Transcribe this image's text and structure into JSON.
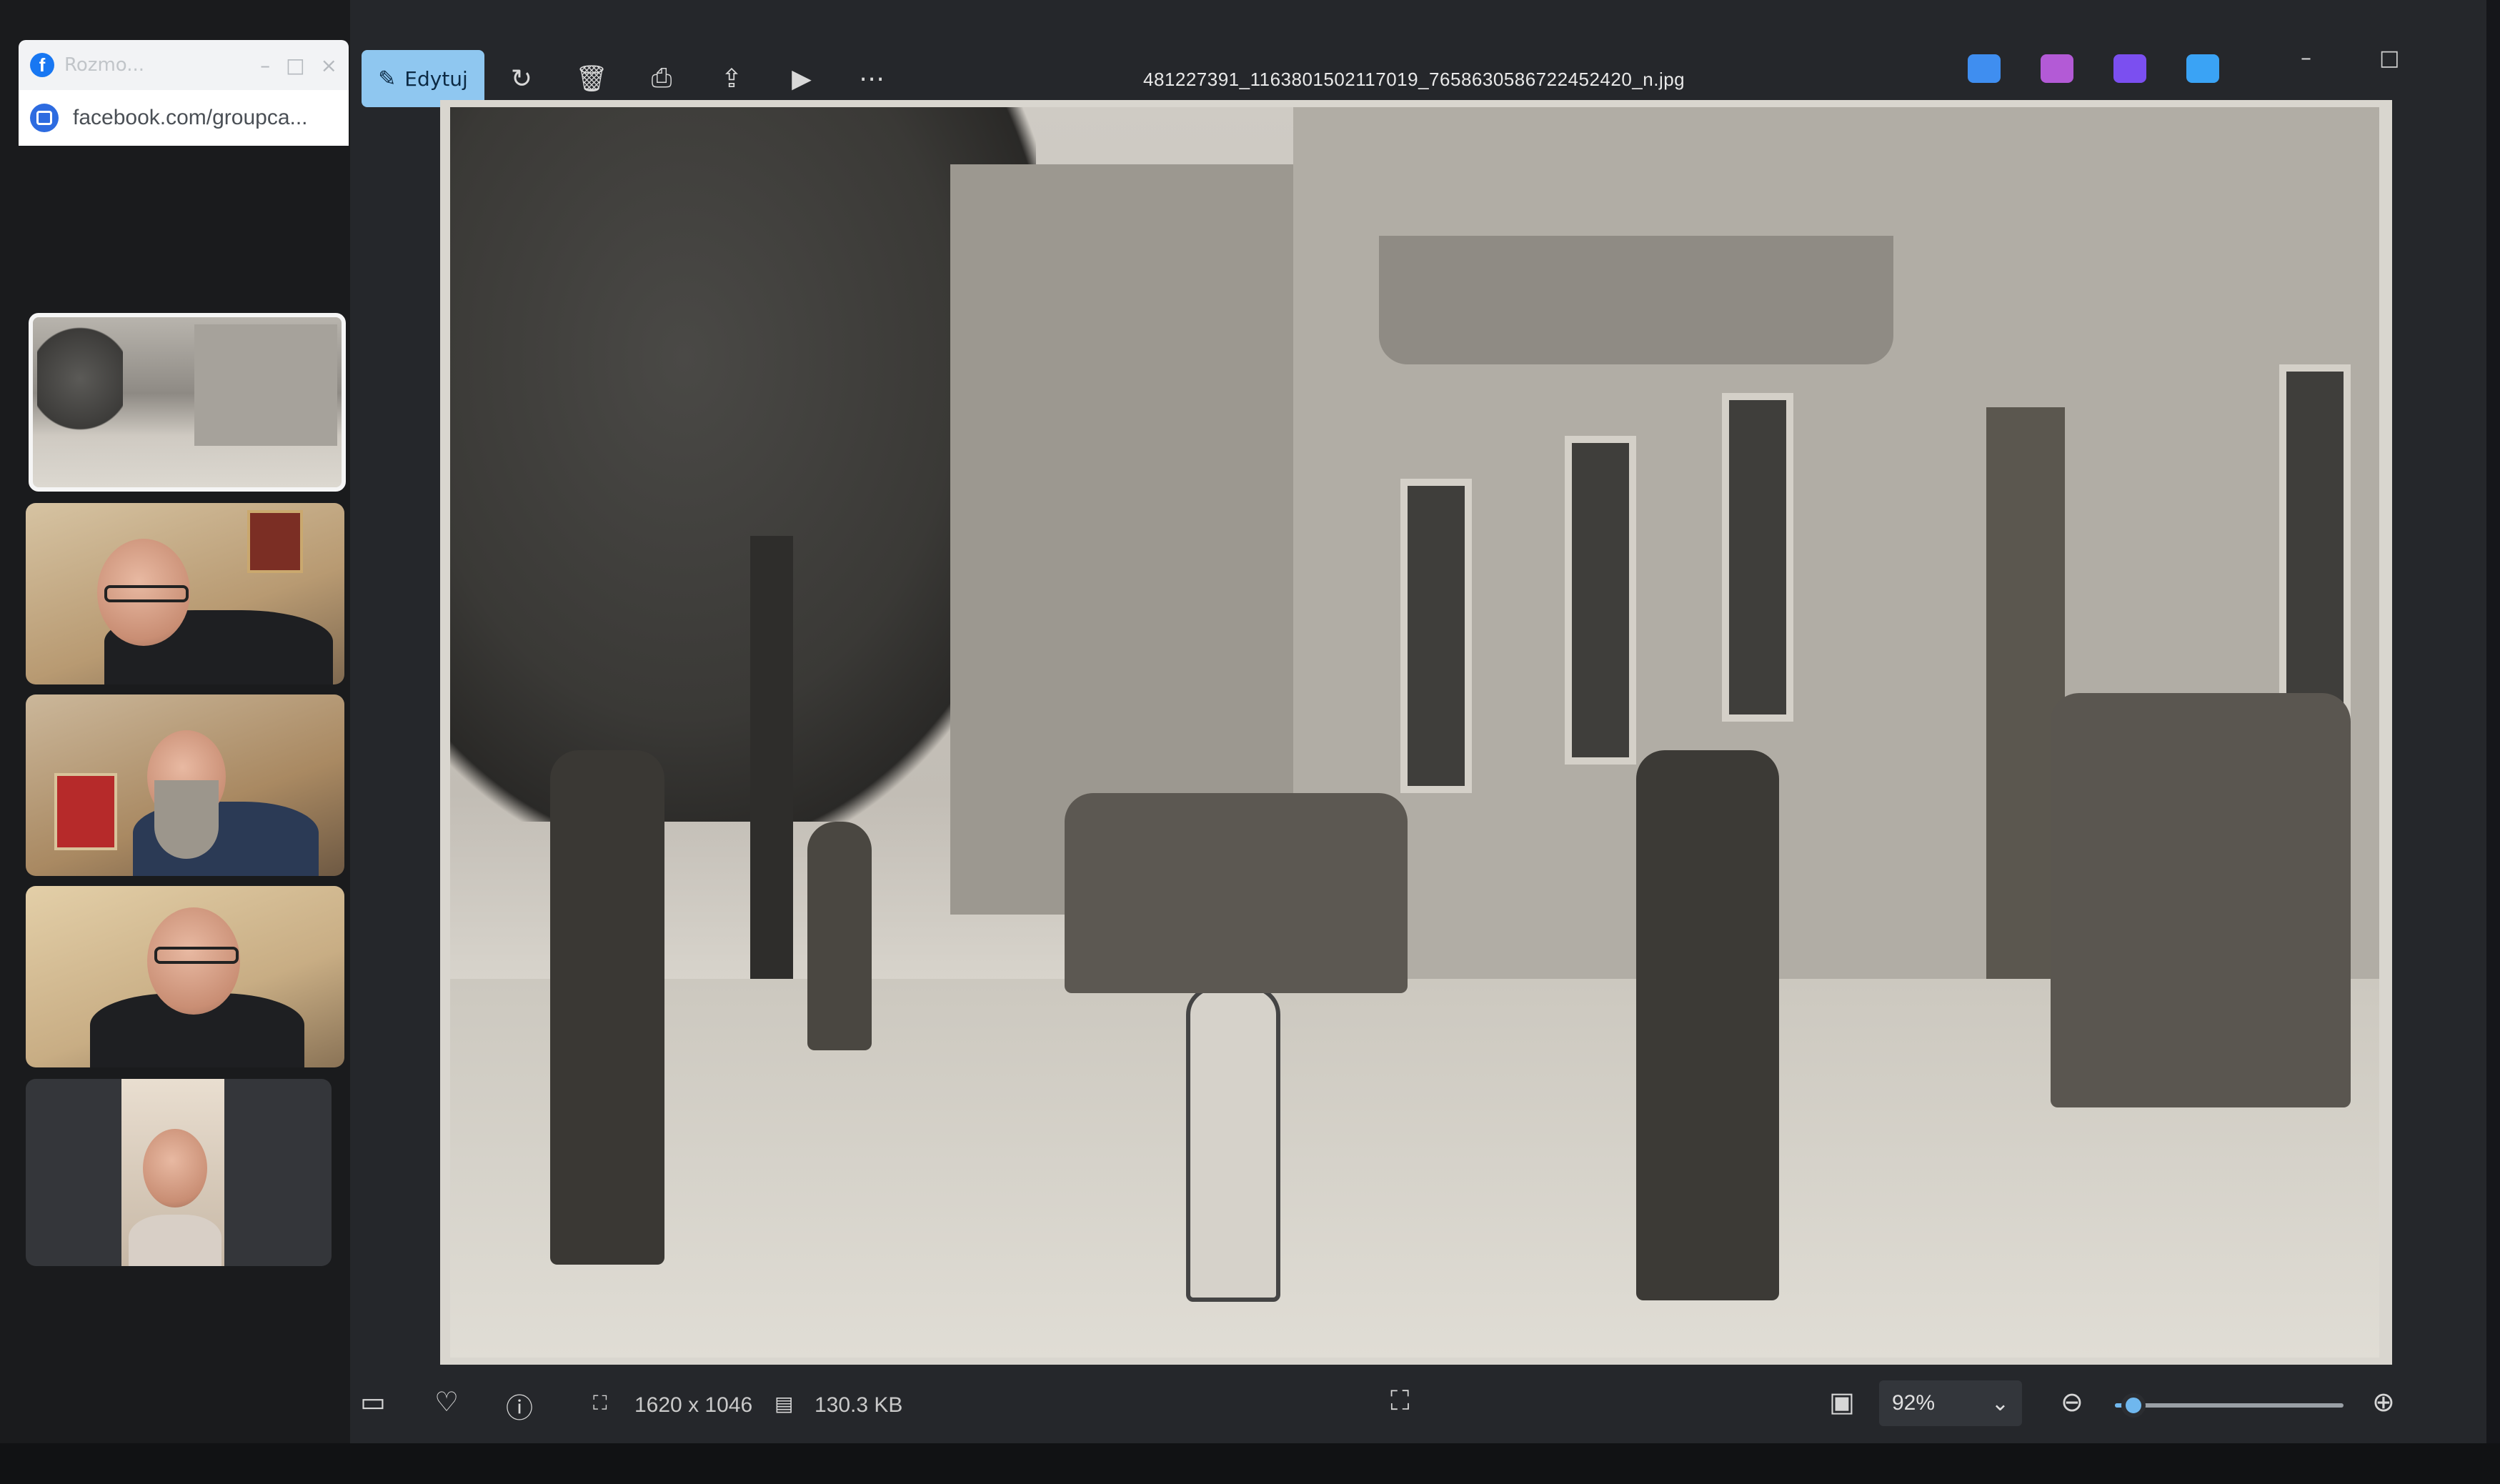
{
  "browser": {
    "tab_title": "Rozmo...",
    "tab_controls": [
      "–",
      "□",
      "×"
    ],
    "address": "facebook.com/groupca..."
  },
  "call": {
    "thumbnails": [
      "shared-photo",
      "participant-1",
      "participant-2",
      "participant-3",
      "participant-4"
    ]
  },
  "viewer": {
    "edit_label": "Edytuj",
    "file_name": "481227391_1163801502117019_7658630586722452420_n.jpg",
    "toolbar_icons": [
      "rotate-icon",
      "delete-icon",
      "print-icon",
      "share-icon",
      "slideshow-icon",
      "more-icon"
    ],
    "app_icons": [
      {
        "name": "app-icon-1",
        "color": "#3f8ef0"
      },
      {
        "name": "app-icon-2",
        "color": "#b35ad6"
      },
      {
        "name": "app-icon-3",
        "color": "#7b4ff0"
      },
      {
        "name": "app-icon-4",
        "color": "#3aa3f5"
      }
    ],
    "window_controls": [
      "–",
      "□"
    ],
    "dimensions": "1620 x 1046",
    "file_size": "130.3 KB",
    "zoom_level": "92%",
    "zoom_fraction": 0.08
  }
}
